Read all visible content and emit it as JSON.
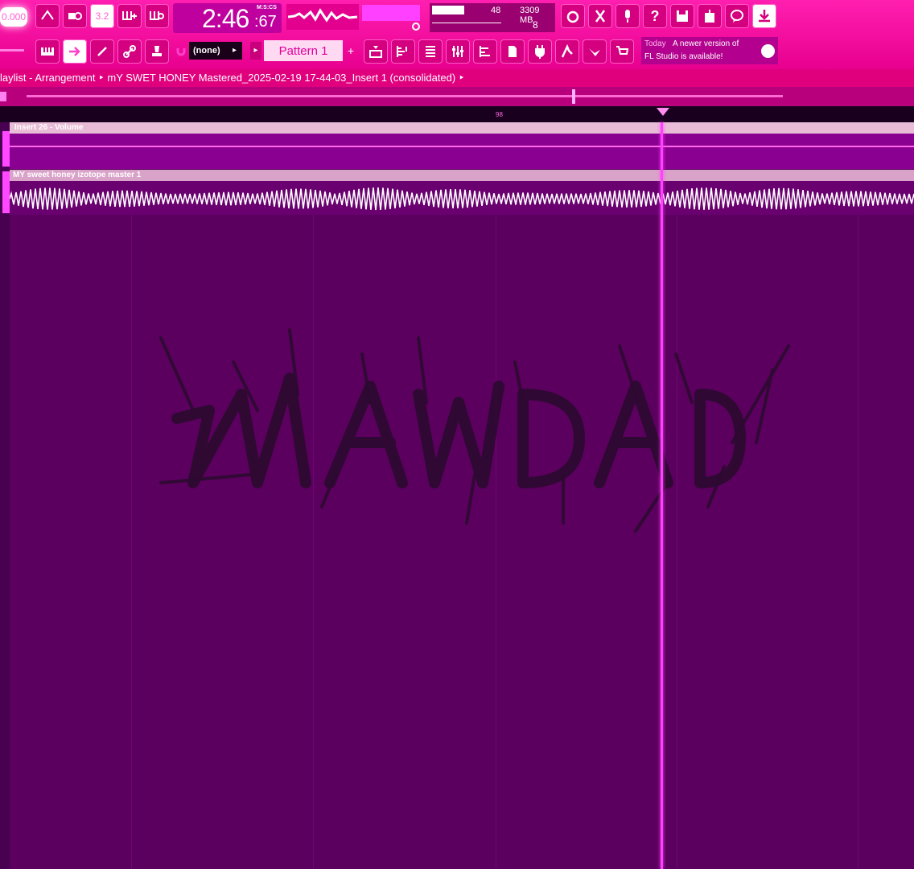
{
  "toolbar": {
    "counter_text": "0.000",
    "time": {
      "main": "2:46",
      "fraction": ":67",
      "unit": "M:S:CS"
    },
    "cpu": {
      "load": "48",
      "memory": "3309 MB",
      "polyphony": "8"
    },
    "snap_value": "(none)",
    "pattern_name": "Pattern 1"
  },
  "hint": {
    "today": "Today",
    "line1": "A newer version of",
    "line2": "FL Studio is available!"
  },
  "breadcrumb": {
    "text": "laylist - Arrangement ‣ mY SWET HONEY Mastered_2025-02-19 17-44-03_Insert 1 (consolidated) ‣"
  },
  "ruler": {
    "bar_label": "98"
  },
  "clips": {
    "automation_title": "Insert 26 - Volume",
    "audio_title": "MY sweet honey izotope master 1"
  },
  "icons": [
    "metronome-icon",
    "wait-record-icon",
    "countdown-icon",
    "step-edit-icon",
    "loop-record-icon",
    "piano-roll-icon",
    "arrow-icon",
    "slide-icon",
    "link-icon",
    "stamp-icon",
    "magnet-icon",
    "playlist-icon",
    "step-sequencer-icon",
    "browser-icon",
    "mixer-icon",
    "channel-rack-icon",
    "plugin-icon",
    "patch-icon",
    "tempo-icon",
    "piano-icon",
    "undo-icon",
    "cut-icon",
    "mic-icon",
    "help-icon",
    "save-icon",
    "export-icon",
    "chat-icon",
    "download-icon"
  ],
  "colors": {
    "accent": "#ff1fb0",
    "background": "#5c005f",
    "playhead": "#ff40ff"
  }
}
